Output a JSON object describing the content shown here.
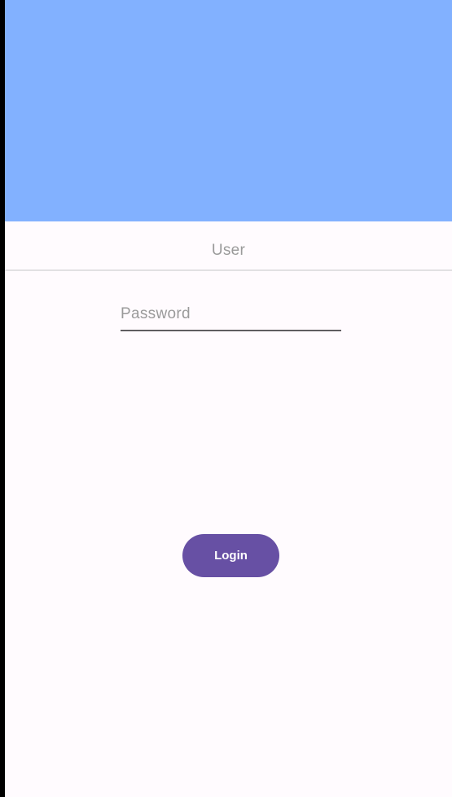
{
  "colors": {
    "header_bg": "#82b1ff",
    "button_bg": "#6750a4"
  },
  "form": {
    "user_placeholder": "User",
    "password_placeholder": "Password",
    "login_label": "Login"
  }
}
